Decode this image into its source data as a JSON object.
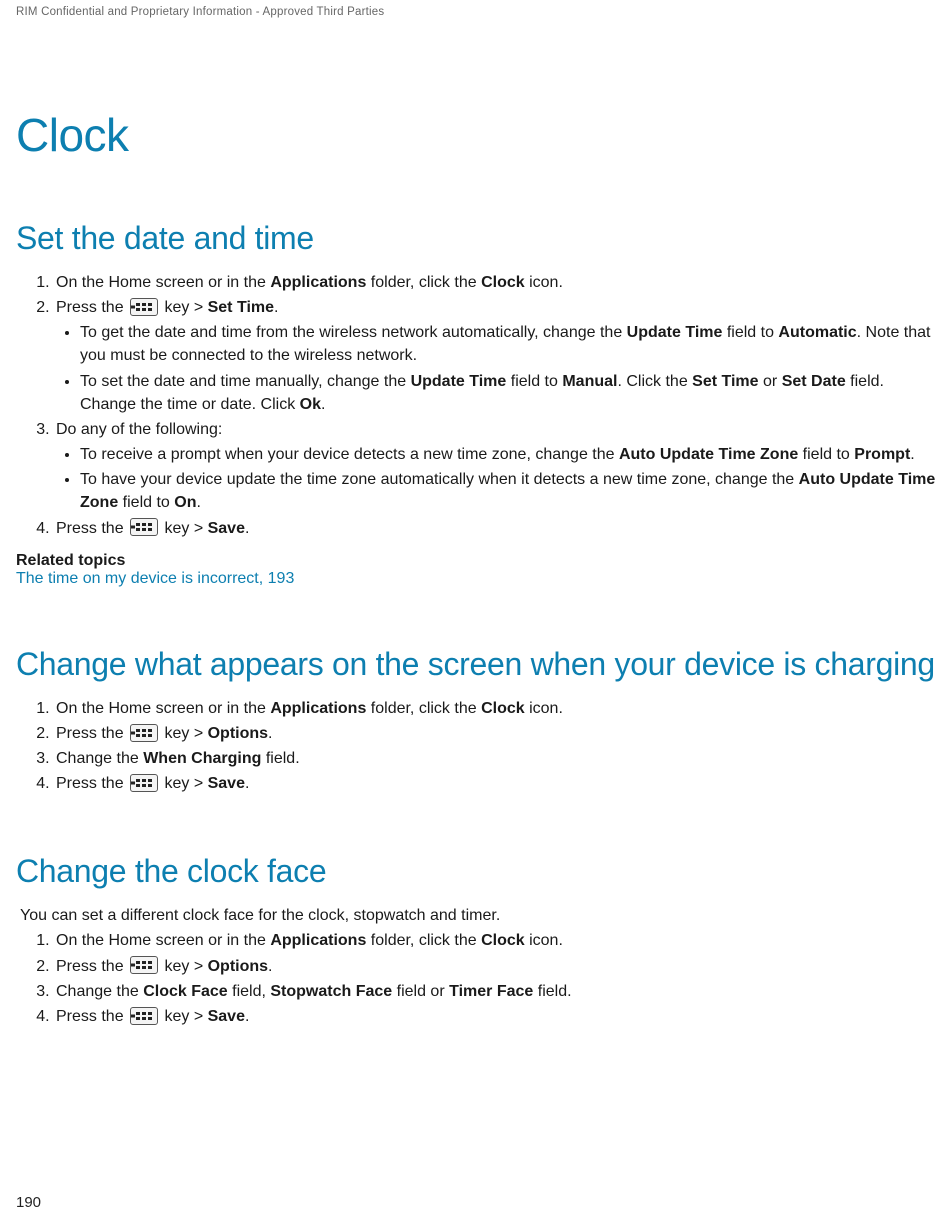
{
  "header": {
    "confidential": "RIM Confidential and Proprietary Information - Approved Third Parties"
  },
  "title": "Clock",
  "page_number": "190",
  "section1": {
    "heading": "Set the date and time",
    "step1_a": "On the Home screen or in the ",
    "step1_b": "Applications",
    "step1_c": " folder, click the ",
    "step1_d": "Clock",
    "step1_e": " icon.",
    "step2_a": "Press the ",
    "step2_b": " key > ",
    "step2_c": "Set Time",
    "step2_d": ".",
    "step2_bullet1_a": "To get the date and time from the wireless network automatically, change the ",
    "step2_bullet1_b": "Update Time",
    "step2_bullet1_c": " field to ",
    "step2_bullet1_d": "Automatic",
    "step2_bullet1_e": ". Note that you must be connected to the wireless network.",
    "step2_bullet2_a": "To set the date and time manually, change the ",
    "step2_bullet2_b": "Update Time",
    "step2_bullet2_c": " field to ",
    "step2_bullet2_d": "Manual",
    "step2_bullet2_e": ". Click the ",
    "step2_bullet2_f": "Set Time",
    "step2_bullet2_g": " or ",
    "step2_bullet2_h": "Set Date",
    "step2_bullet2_i": " field. Change the time or date. Click ",
    "step2_bullet2_j": "Ok",
    "step2_bullet2_k": ".",
    "step3": "Do any of the following:",
    "step3_bullet1_a": "To receive a prompt when your device detects a new time zone, change the ",
    "step3_bullet1_b": "Auto Update Time Zone",
    "step3_bullet1_c": " field to ",
    "step3_bullet1_d": "Prompt",
    "step3_bullet1_e": ".",
    "step3_bullet2_a": "To have your device update the time zone automatically when it detects a new time zone, change the ",
    "step3_bullet2_b": "Auto Update Time Zone",
    "step3_bullet2_c": " field to ",
    "step3_bullet2_d": "On",
    "step3_bullet2_e": ".",
    "step4_a": "Press the ",
    "step4_b": " key > ",
    "step4_c": "Save",
    "step4_d": ".",
    "related_label": "Related topics",
    "related_link": "The time on my device is incorrect, 193"
  },
  "section2": {
    "heading": "Change what appears on the screen when your device is charging",
    "step1_a": "On the Home screen or in the ",
    "step1_b": "Applications",
    "step1_c": " folder, click the ",
    "step1_d": "Clock",
    "step1_e": " icon.",
    "step2_a": "Press the ",
    "step2_b": " key > ",
    "step2_c": "Options",
    "step2_d": ".",
    "step3_a": "Change the ",
    "step3_b": "When Charging",
    "step3_c": " field.",
    "step4_a": "Press the ",
    "step4_b": " key > ",
    "step4_c": "Save",
    "step4_d": "."
  },
  "section3": {
    "heading": "Change the clock face",
    "intro": "You can set a different clock face for the clock, stopwatch and timer.",
    "step1_a": "On the Home screen or in the ",
    "step1_b": "Applications",
    "step1_c": " folder, click the ",
    "step1_d": "Clock",
    "step1_e": " icon.",
    "step2_a": "Press the ",
    "step2_b": " key > ",
    "step2_c": "Options",
    "step2_d": ".",
    "step3_a": "Change the ",
    "step3_b": "Clock Face",
    "step3_c": " field, ",
    "step3_d": "Stopwatch Face",
    "step3_e": " field or ",
    "step3_f": "Timer Face",
    "step3_g": " field.",
    "step4_a": "Press the ",
    "step4_b": " key > ",
    "step4_c": "Save",
    "step4_d": "."
  }
}
